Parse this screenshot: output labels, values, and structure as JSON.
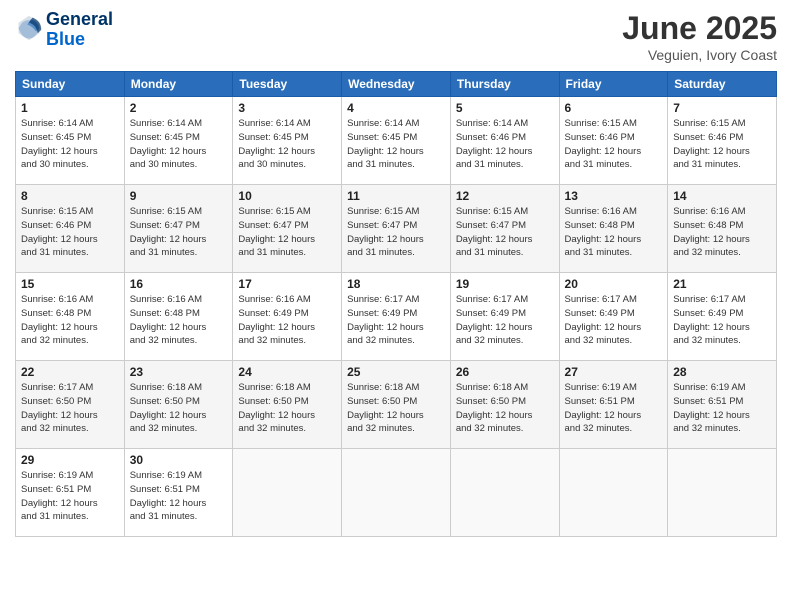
{
  "logo": {
    "line1": "General",
    "line2": "Blue"
  },
  "title": "June 2025",
  "location": "Veguien, Ivory Coast",
  "days_of_week": [
    "Sunday",
    "Monday",
    "Tuesday",
    "Wednesday",
    "Thursday",
    "Friday",
    "Saturday"
  ],
  "weeks": [
    [
      {
        "day": "1",
        "info": "Sunrise: 6:14 AM\nSunset: 6:45 PM\nDaylight: 12 hours\nand 30 minutes."
      },
      {
        "day": "2",
        "info": "Sunrise: 6:14 AM\nSunset: 6:45 PM\nDaylight: 12 hours\nand 30 minutes."
      },
      {
        "day": "3",
        "info": "Sunrise: 6:14 AM\nSunset: 6:45 PM\nDaylight: 12 hours\nand 30 minutes."
      },
      {
        "day": "4",
        "info": "Sunrise: 6:14 AM\nSunset: 6:45 PM\nDaylight: 12 hours\nand 31 minutes."
      },
      {
        "day": "5",
        "info": "Sunrise: 6:14 AM\nSunset: 6:46 PM\nDaylight: 12 hours\nand 31 minutes."
      },
      {
        "day": "6",
        "info": "Sunrise: 6:15 AM\nSunset: 6:46 PM\nDaylight: 12 hours\nand 31 minutes."
      },
      {
        "day": "7",
        "info": "Sunrise: 6:15 AM\nSunset: 6:46 PM\nDaylight: 12 hours\nand 31 minutes."
      }
    ],
    [
      {
        "day": "8",
        "info": "Sunrise: 6:15 AM\nSunset: 6:46 PM\nDaylight: 12 hours\nand 31 minutes."
      },
      {
        "day": "9",
        "info": "Sunrise: 6:15 AM\nSunset: 6:47 PM\nDaylight: 12 hours\nand 31 minutes."
      },
      {
        "day": "10",
        "info": "Sunrise: 6:15 AM\nSunset: 6:47 PM\nDaylight: 12 hours\nand 31 minutes."
      },
      {
        "day": "11",
        "info": "Sunrise: 6:15 AM\nSunset: 6:47 PM\nDaylight: 12 hours\nand 31 minutes."
      },
      {
        "day": "12",
        "info": "Sunrise: 6:15 AM\nSunset: 6:47 PM\nDaylight: 12 hours\nand 31 minutes."
      },
      {
        "day": "13",
        "info": "Sunrise: 6:16 AM\nSunset: 6:48 PM\nDaylight: 12 hours\nand 31 minutes."
      },
      {
        "day": "14",
        "info": "Sunrise: 6:16 AM\nSunset: 6:48 PM\nDaylight: 12 hours\nand 32 minutes."
      }
    ],
    [
      {
        "day": "15",
        "info": "Sunrise: 6:16 AM\nSunset: 6:48 PM\nDaylight: 12 hours\nand 32 minutes."
      },
      {
        "day": "16",
        "info": "Sunrise: 6:16 AM\nSunset: 6:48 PM\nDaylight: 12 hours\nand 32 minutes."
      },
      {
        "day": "17",
        "info": "Sunrise: 6:16 AM\nSunset: 6:49 PM\nDaylight: 12 hours\nand 32 minutes."
      },
      {
        "day": "18",
        "info": "Sunrise: 6:17 AM\nSunset: 6:49 PM\nDaylight: 12 hours\nand 32 minutes."
      },
      {
        "day": "19",
        "info": "Sunrise: 6:17 AM\nSunset: 6:49 PM\nDaylight: 12 hours\nand 32 minutes."
      },
      {
        "day": "20",
        "info": "Sunrise: 6:17 AM\nSunset: 6:49 PM\nDaylight: 12 hours\nand 32 minutes."
      },
      {
        "day": "21",
        "info": "Sunrise: 6:17 AM\nSunset: 6:49 PM\nDaylight: 12 hours\nand 32 minutes."
      }
    ],
    [
      {
        "day": "22",
        "info": "Sunrise: 6:17 AM\nSunset: 6:50 PM\nDaylight: 12 hours\nand 32 minutes."
      },
      {
        "day": "23",
        "info": "Sunrise: 6:18 AM\nSunset: 6:50 PM\nDaylight: 12 hours\nand 32 minutes."
      },
      {
        "day": "24",
        "info": "Sunrise: 6:18 AM\nSunset: 6:50 PM\nDaylight: 12 hours\nand 32 minutes."
      },
      {
        "day": "25",
        "info": "Sunrise: 6:18 AM\nSunset: 6:50 PM\nDaylight: 12 hours\nand 32 minutes."
      },
      {
        "day": "26",
        "info": "Sunrise: 6:18 AM\nSunset: 6:50 PM\nDaylight: 12 hours\nand 32 minutes."
      },
      {
        "day": "27",
        "info": "Sunrise: 6:19 AM\nSunset: 6:51 PM\nDaylight: 12 hours\nand 32 minutes."
      },
      {
        "day": "28",
        "info": "Sunrise: 6:19 AM\nSunset: 6:51 PM\nDaylight: 12 hours\nand 32 minutes."
      }
    ],
    [
      {
        "day": "29",
        "info": "Sunrise: 6:19 AM\nSunset: 6:51 PM\nDaylight: 12 hours\nand 31 minutes."
      },
      {
        "day": "30",
        "info": "Sunrise: 6:19 AM\nSunset: 6:51 PM\nDaylight: 12 hours\nand 31 minutes."
      },
      {
        "day": "",
        "info": ""
      },
      {
        "day": "",
        "info": ""
      },
      {
        "day": "",
        "info": ""
      },
      {
        "day": "",
        "info": ""
      },
      {
        "day": "",
        "info": ""
      }
    ]
  ]
}
